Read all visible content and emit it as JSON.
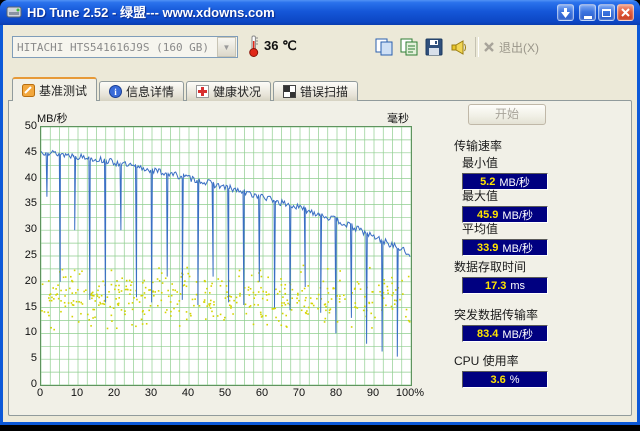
{
  "window": {
    "title": "HD Tune 2.52 - 绿盟--- www.xdowns.com"
  },
  "titlebar_icons": {
    "app": "hd-tune-app-icon",
    "download": "download-arrow-icon",
    "minimize": "minimize-icon",
    "maximize": "maximize-icon",
    "close": "close-icon"
  },
  "toolbar": {
    "drive": "HITACHI HTS541616J9S (160 GB)",
    "temperature": "36 ℃",
    "icons": [
      "copy-image-icon",
      "copy-info-icon",
      "save-icon",
      "speaker-icon"
    ],
    "exit_label": "退出(X)"
  },
  "tabs": [
    "基准测试",
    "信息详情",
    "健康状况",
    "错误扫描"
  ],
  "benchmark": {
    "start_button": "开始",
    "group_transfer_label": "传输速率",
    "measurements": {
      "min": {
        "label": "最小值",
        "value": "5.2",
        "unit": "MB/秒"
      },
      "max": {
        "label": "最大值",
        "value": "45.9",
        "unit": "MB/秒"
      },
      "avg": {
        "label": "平均值",
        "value": "33.9",
        "unit": "MB/秒"
      },
      "access": {
        "label": "数据存取时间",
        "value": "17.3",
        "unit": "ms"
      },
      "burst": {
        "label": "突发数据传输率",
        "value": "83.4",
        "unit": "MB/秒"
      },
      "cpu": {
        "label": "CPU 使用率",
        "value": "3.6",
        "unit": "%"
      }
    },
    "value_box": {
      "bg": "#000080",
      "value_color": "#ffe400",
      "unit_color": "#ffffff"
    }
  },
  "chart_data": {
    "type": "line",
    "title": "",
    "y_axis_label": "MB/秒",
    "y2_axis_label": "毫秒",
    "xlim": [
      0,
      100
    ],
    "ylim": [
      0,
      50
    ],
    "grid_step": 2.5,
    "grid_color": "#8fce8f",
    "x_tick_labels": [
      "0",
      "10",
      "20",
      "30",
      "40",
      "50",
      "60",
      "70",
      "80",
      "90",
      "100%"
    ],
    "y_ticks": [
      0,
      5,
      10,
      15,
      20,
      25,
      30,
      35,
      40,
      45,
      50
    ],
    "series": [
      {
        "name": "transfer-rate",
        "color": "#3a6fc4",
        "noise": 1.3,
        "seed": 13,
        "envelope": [
          [
            0,
            45.2
          ],
          [
            5,
            44.8
          ],
          [
            10,
            44.3
          ],
          [
            15,
            43.8
          ],
          [
            20,
            43.1
          ],
          [
            25,
            42.3
          ],
          [
            30,
            41.6
          ],
          [
            35,
            40.9
          ],
          [
            40,
            40.1
          ],
          [
            45,
            39.2
          ],
          [
            50,
            38.3
          ],
          [
            55,
            37.3
          ],
          [
            60,
            36.4
          ],
          [
            65,
            35.3
          ],
          [
            70,
            34.3
          ],
          [
            75,
            33.2
          ],
          [
            80,
            31.9
          ],
          [
            85,
            30.4
          ],
          [
            90,
            28.7
          ],
          [
            95,
            27.1
          ],
          [
            100,
            25.3
          ]
        ],
        "dips": [
          [
            1.6,
            36.5
          ],
          [
            5.2,
            20
          ],
          [
            9.1,
            30
          ],
          [
            13.2,
            16.5
          ],
          [
            17.4,
            16
          ],
          [
            21.6,
            30
          ],
          [
            25.8,
            17
          ],
          [
            29.9,
            16
          ],
          [
            34.1,
            21
          ],
          [
            38.2,
            16.5
          ],
          [
            42.4,
            15.5
          ],
          [
            46.5,
            21
          ],
          [
            50.7,
            16
          ],
          [
            54.8,
            15.5
          ],
          [
            59.0,
            20
          ],
          [
            63.1,
            15
          ],
          [
            67.3,
            14.5
          ],
          [
            71.4,
            19
          ],
          [
            75.6,
            14
          ],
          [
            79.7,
            10
          ],
          [
            83.9,
            13
          ],
          [
            88.0,
            8
          ],
          [
            92.2,
            6.5
          ],
          [
            96.3,
            5.5
          ]
        ]
      }
    ],
    "scatter": {
      "name": "access-time-dots",
      "color": "#d4d400",
      "count": 430,
      "seed": 5,
      "y_center": 17,
      "y_spread": 6.5,
      "y_min": 10,
      "y_max": 23.5
    }
  }
}
